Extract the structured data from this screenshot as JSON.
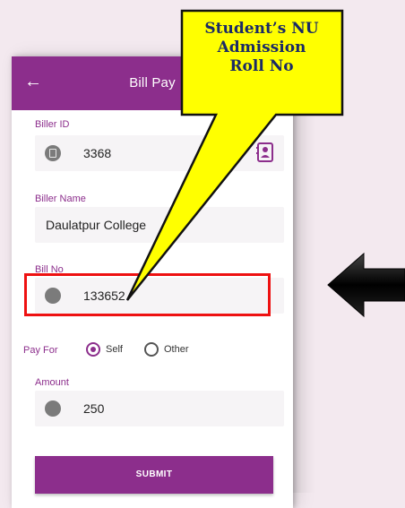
{
  "appbar": {
    "title": "Bill Pay",
    "back_icon": "arrow-left"
  },
  "form": {
    "biller_id": {
      "label": "Biller ID",
      "value": "3368",
      "icon": "document-icon",
      "side_icon": "contact-book-icon"
    },
    "biller_name": {
      "label": "Biller Name",
      "value": "Daulatpur College"
    },
    "bill_no": {
      "label": "Bill No",
      "value": "133652"
    },
    "pay_for": {
      "label": "Pay For",
      "options": [
        "Self",
        "Other"
      ],
      "selected": "Self"
    },
    "amount": {
      "label": "Amount",
      "value": "250"
    },
    "submit_label": "SUBMIT"
  },
  "callout": {
    "lines": [
      "Student’s NU",
      "Admission",
      "Roll No"
    ]
  },
  "colors": {
    "brand": "#8c2e8c",
    "highlight": "#ee1111",
    "callout_fill": "#ffff00"
  }
}
